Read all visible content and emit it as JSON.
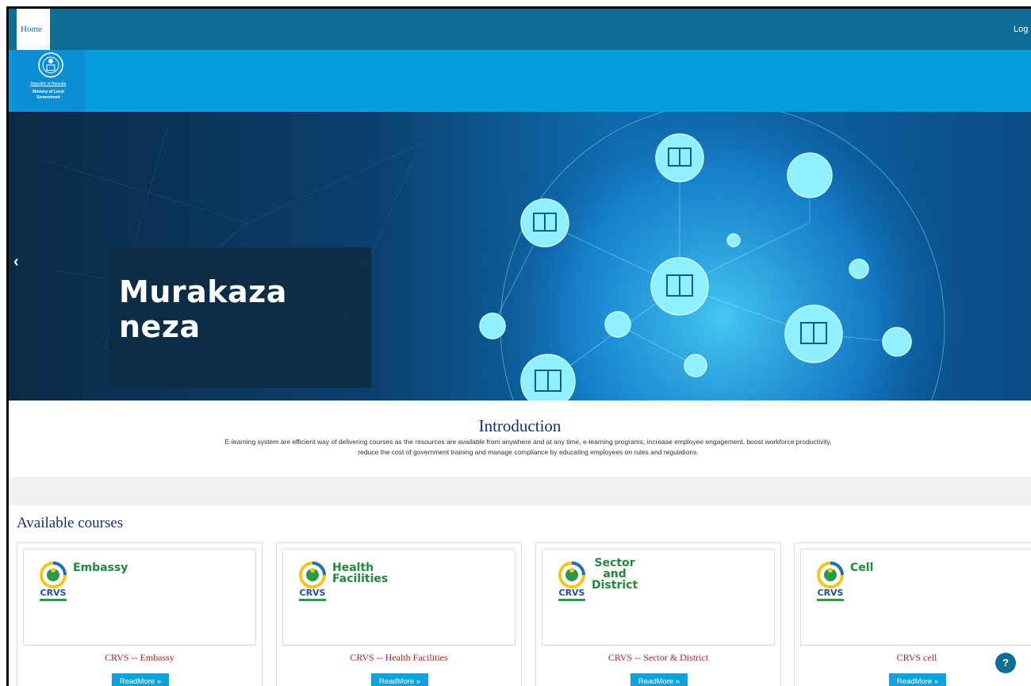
{
  "nav": {
    "home_label": "Home",
    "login_label": "Log in"
  },
  "logo": {
    "line1": "Republic of Rwanda",
    "line2": "Ministry of Local",
    "line3": "Government"
  },
  "hero": {
    "caption": "Murakaza neza",
    "prev_icon": "‹"
  },
  "intro": {
    "title": "Introduction",
    "text": "E-learning system are efficient way of delivering courses as the resources are available from anywhere and at any time, e-learning programs, increase employee engagement, boost workforce productivity, reduce the cost of government training and manage compliance by educating employees on rules and regulations."
  },
  "courses": {
    "title": "Available courses",
    "readmore_label": "ReadMore  »",
    "items": [
      {
        "image_text": "Embassy",
        "logo_text": "CRVS",
        "name": "CRVS -- Embassy"
      },
      {
        "image_text": "Health\nFacilities",
        "logo_text": "CRVS",
        "name": "CRVS -- Health Facilities"
      },
      {
        "image_text": "Sector\nand\nDistrict",
        "logo_text": "CRVS",
        "name": "CRVS -- Sector & District"
      },
      {
        "image_text": "Cell",
        "logo_text": "CRVS",
        "name": "CRVS cell"
      }
    ]
  },
  "help": {
    "label": "?"
  },
  "colors": {
    "nav": "#0e6e96",
    "logobar": "#049ddd",
    "title": "#1c2f6e",
    "course_name": "#b22222",
    "button": "#12a1df",
    "crvs_green": "#1e8a3a"
  }
}
